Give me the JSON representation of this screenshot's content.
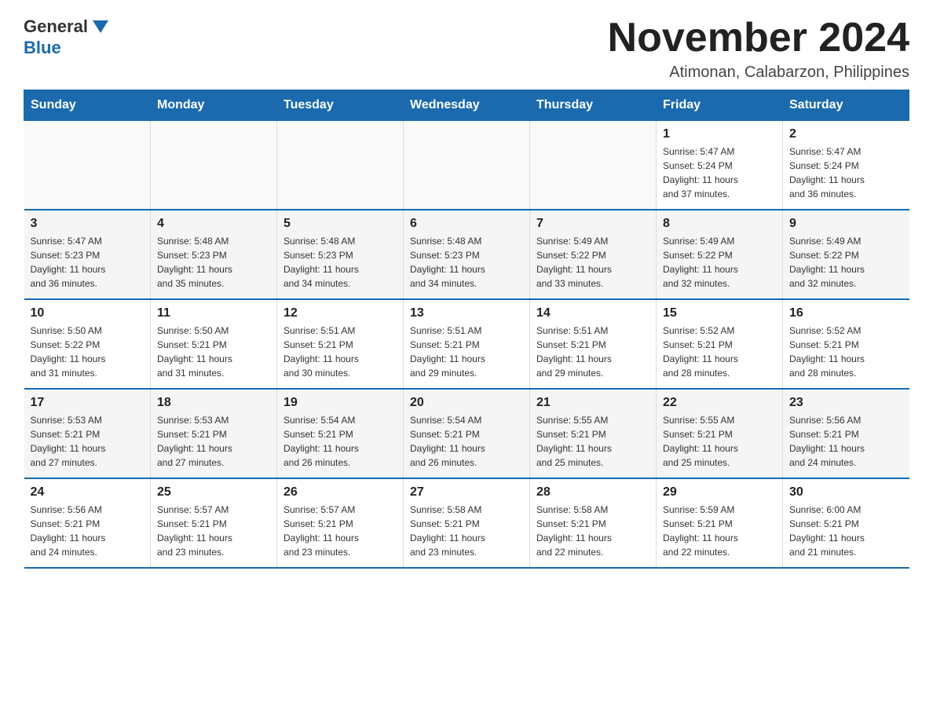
{
  "header": {
    "logo_general": "General",
    "logo_blue": "Blue",
    "month_title": "November 2024",
    "location": "Atimonan, Calabarzon, Philippines"
  },
  "weekdays": [
    "Sunday",
    "Monday",
    "Tuesday",
    "Wednesday",
    "Thursday",
    "Friday",
    "Saturday"
  ],
  "weeks": [
    [
      {
        "day": "",
        "info": ""
      },
      {
        "day": "",
        "info": ""
      },
      {
        "day": "",
        "info": ""
      },
      {
        "day": "",
        "info": ""
      },
      {
        "day": "",
        "info": ""
      },
      {
        "day": "1",
        "info": "Sunrise: 5:47 AM\nSunset: 5:24 PM\nDaylight: 11 hours\nand 37 minutes."
      },
      {
        "day": "2",
        "info": "Sunrise: 5:47 AM\nSunset: 5:24 PM\nDaylight: 11 hours\nand 36 minutes."
      }
    ],
    [
      {
        "day": "3",
        "info": "Sunrise: 5:47 AM\nSunset: 5:23 PM\nDaylight: 11 hours\nand 36 minutes."
      },
      {
        "day": "4",
        "info": "Sunrise: 5:48 AM\nSunset: 5:23 PM\nDaylight: 11 hours\nand 35 minutes."
      },
      {
        "day": "5",
        "info": "Sunrise: 5:48 AM\nSunset: 5:23 PM\nDaylight: 11 hours\nand 34 minutes."
      },
      {
        "day": "6",
        "info": "Sunrise: 5:48 AM\nSunset: 5:23 PM\nDaylight: 11 hours\nand 34 minutes."
      },
      {
        "day": "7",
        "info": "Sunrise: 5:49 AM\nSunset: 5:22 PM\nDaylight: 11 hours\nand 33 minutes."
      },
      {
        "day": "8",
        "info": "Sunrise: 5:49 AM\nSunset: 5:22 PM\nDaylight: 11 hours\nand 32 minutes."
      },
      {
        "day": "9",
        "info": "Sunrise: 5:49 AM\nSunset: 5:22 PM\nDaylight: 11 hours\nand 32 minutes."
      }
    ],
    [
      {
        "day": "10",
        "info": "Sunrise: 5:50 AM\nSunset: 5:22 PM\nDaylight: 11 hours\nand 31 minutes."
      },
      {
        "day": "11",
        "info": "Sunrise: 5:50 AM\nSunset: 5:21 PM\nDaylight: 11 hours\nand 31 minutes."
      },
      {
        "day": "12",
        "info": "Sunrise: 5:51 AM\nSunset: 5:21 PM\nDaylight: 11 hours\nand 30 minutes."
      },
      {
        "day": "13",
        "info": "Sunrise: 5:51 AM\nSunset: 5:21 PM\nDaylight: 11 hours\nand 29 minutes."
      },
      {
        "day": "14",
        "info": "Sunrise: 5:51 AM\nSunset: 5:21 PM\nDaylight: 11 hours\nand 29 minutes."
      },
      {
        "day": "15",
        "info": "Sunrise: 5:52 AM\nSunset: 5:21 PM\nDaylight: 11 hours\nand 28 minutes."
      },
      {
        "day": "16",
        "info": "Sunrise: 5:52 AM\nSunset: 5:21 PM\nDaylight: 11 hours\nand 28 minutes."
      }
    ],
    [
      {
        "day": "17",
        "info": "Sunrise: 5:53 AM\nSunset: 5:21 PM\nDaylight: 11 hours\nand 27 minutes."
      },
      {
        "day": "18",
        "info": "Sunrise: 5:53 AM\nSunset: 5:21 PM\nDaylight: 11 hours\nand 27 minutes."
      },
      {
        "day": "19",
        "info": "Sunrise: 5:54 AM\nSunset: 5:21 PM\nDaylight: 11 hours\nand 26 minutes."
      },
      {
        "day": "20",
        "info": "Sunrise: 5:54 AM\nSunset: 5:21 PM\nDaylight: 11 hours\nand 26 minutes."
      },
      {
        "day": "21",
        "info": "Sunrise: 5:55 AM\nSunset: 5:21 PM\nDaylight: 11 hours\nand 25 minutes."
      },
      {
        "day": "22",
        "info": "Sunrise: 5:55 AM\nSunset: 5:21 PM\nDaylight: 11 hours\nand 25 minutes."
      },
      {
        "day": "23",
        "info": "Sunrise: 5:56 AM\nSunset: 5:21 PM\nDaylight: 11 hours\nand 24 minutes."
      }
    ],
    [
      {
        "day": "24",
        "info": "Sunrise: 5:56 AM\nSunset: 5:21 PM\nDaylight: 11 hours\nand 24 minutes."
      },
      {
        "day": "25",
        "info": "Sunrise: 5:57 AM\nSunset: 5:21 PM\nDaylight: 11 hours\nand 23 minutes."
      },
      {
        "day": "26",
        "info": "Sunrise: 5:57 AM\nSunset: 5:21 PM\nDaylight: 11 hours\nand 23 minutes."
      },
      {
        "day": "27",
        "info": "Sunrise: 5:58 AM\nSunset: 5:21 PM\nDaylight: 11 hours\nand 23 minutes."
      },
      {
        "day": "28",
        "info": "Sunrise: 5:58 AM\nSunset: 5:21 PM\nDaylight: 11 hours\nand 22 minutes."
      },
      {
        "day": "29",
        "info": "Sunrise: 5:59 AM\nSunset: 5:21 PM\nDaylight: 11 hours\nand 22 minutes."
      },
      {
        "day": "30",
        "info": "Sunrise: 6:00 AM\nSunset: 5:21 PM\nDaylight: 11 hours\nand 21 minutes."
      }
    ]
  ]
}
